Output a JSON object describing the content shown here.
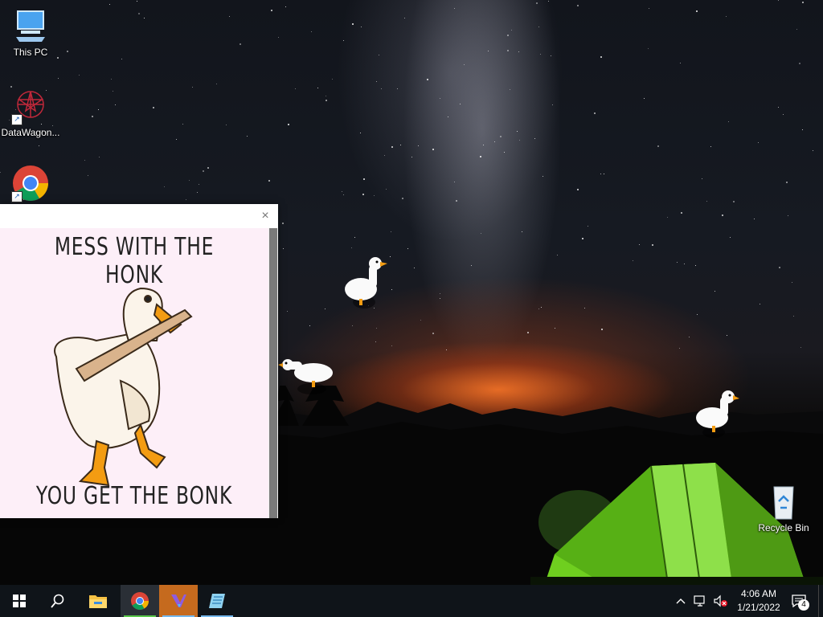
{
  "desktop_icons": [
    {
      "label": "This PC",
      "icon": "computer-icon"
    },
    {
      "label": "DataWagon...",
      "icon": "datawagon-icon"
    },
    {
      "label": "",
      "icon": "chrome-icon"
    },
    {
      "label": "Recycle Bin",
      "icon": "recycle-bin-icon"
    }
  ],
  "popup": {
    "close_glyph": "×",
    "top_text": "MESS WITH THE HONK",
    "bottom_text": "YOU GET THE BONK"
  },
  "taskbar": {
    "start_icon": "windows-logo-icon",
    "search_icon": "search-icon",
    "apps": [
      {
        "name": "File Explorer",
        "icon": "folder-icon"
      },
      {
        "name": "Google Chrome",
        "icon": "chrome-icon"
      },
      {
        "name": "Visual Studio",
        "icon": "visual-studio-icon"
      },
      {
        "name": "Notepad",
        "icon": "notepad-icon"
      }
    ],
    "tray": {
      "chevron": "^",
      "clock_time": "4:06 AM",
      "clock_date": "1/21/2022",
      "notification_count": "4"
    }
  },
  "colors": {
    "taskbar": "#0f1419",
    "popup_background": "#fdeff8",
    "active_underline": "#76b9ed",
    "tent_green": "#7ed321"
  }
}
